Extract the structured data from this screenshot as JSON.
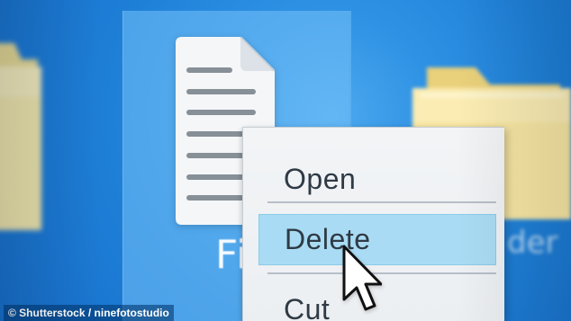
{
  "desktop": {
    "colors": {
      "background": "#1f86db",
      "selection": "#74c1f7",
      "folder": "#f6e39b",
      "menu": "#eceff2",
      "highlight": "#a9dcf4",
      "text": "#2f3a45"
    }
  },
  "file_icon": {
    "icon": "document-icon",
    "label": "Fi"
  },
  "folders": [
    {
      "icon": "folder-icon",
      "label": ""
    },
    {
      "icon": "folder-icon",
      "label": "der"
    }
  ],
  "context_menu": {
    "items": [
      {
        "label": "Open"
      },
      {
        "label": "Delete",
        "selected": true
      },
      {
        "label": "Cut"
      }
    ]
  },
  "cursor": {
    "icon": "arrow-cursor-icon"
  },
  "watermark": {
    "text": "© Shutterstock / ninefotostudio"
  }
}
